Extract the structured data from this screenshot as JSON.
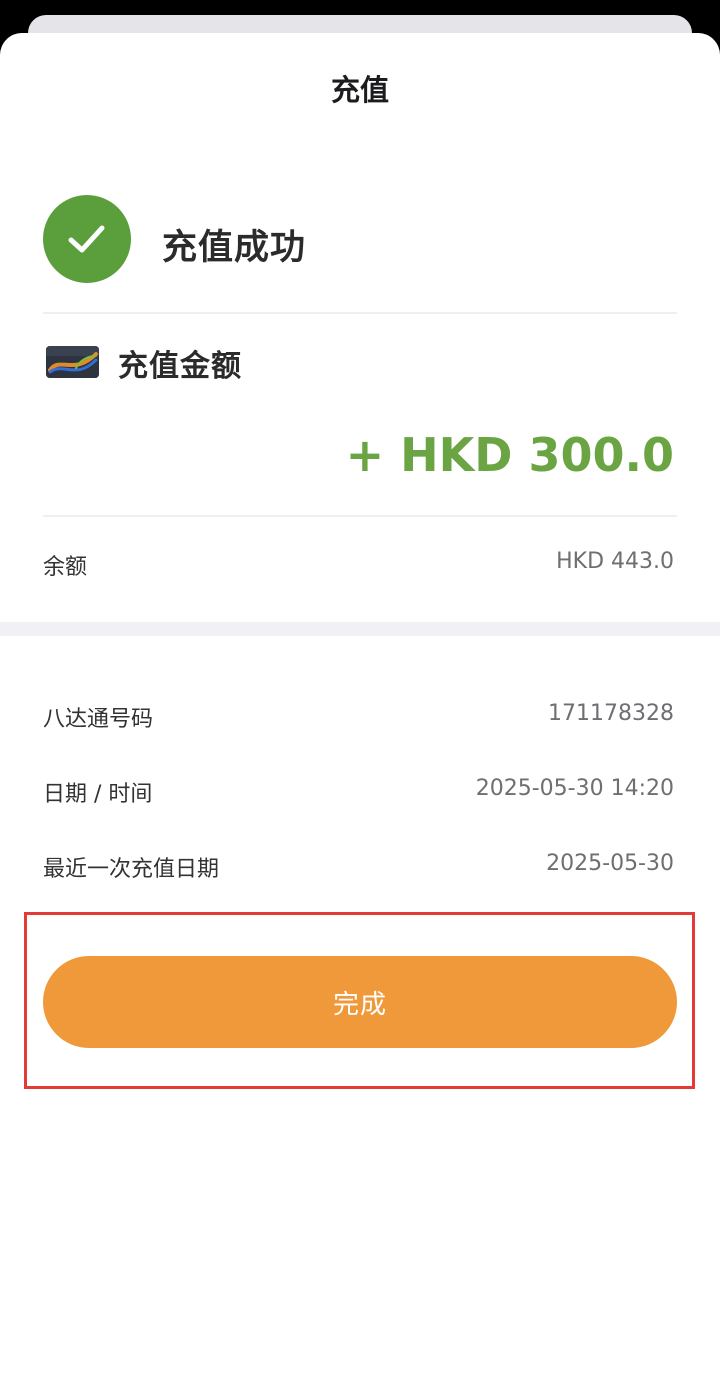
{
  "header": {
    "title": "充值"
  },
  "status": {
    "text": "充值成功",
    "icon": "check-icon",
    "color": "#5a9f3c"
  },
  "topup": {
    "label": "充值金额",
    "amount": "+ HKD 300.0",
    "amount_color": "#6aa443",
    "card_icon": "octopus-card-icon"
  },
  "balance": {
    "label": "余额",
    "value": "HKD 443.0"
  },
  "details": {
    "card_number_label": "八达通号码",
    "card_number": "171178328",
    "datetime_label": "日期 / 时间",
    "datetime": "2025-05-30 14:20",
    "last_topup_label": "最近一次充值日期",
    "last_topup": "2025-05-30"
  },
  "actions": {
    "done_label": "完成",
    "done_color": "#f0993a",
    "highlight_color": "#e53935"
  }
}
